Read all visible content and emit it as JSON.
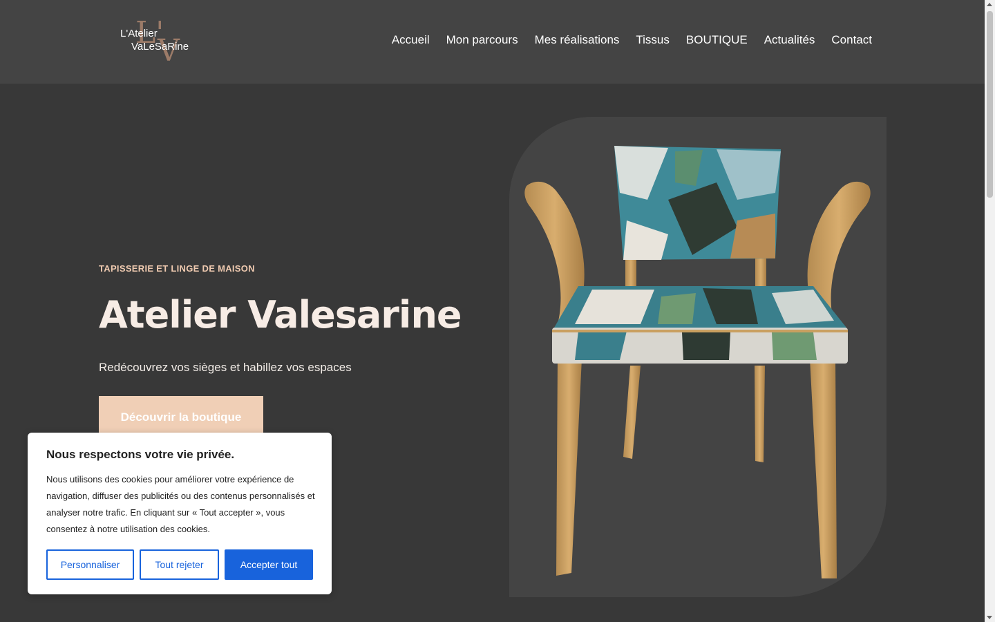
{
  "header": {
    "logo": {
      "line1": "L'Atelier",
      "line2": "VaLeSaRine",
      "mark1": "L'",
      "mark2": "V"
    },
    "nav": [
      "Accueil",
      "Mon parcours",
      "Mes réalisations",
      "Tissus",
      "BOUTIQUE",
      "Actualités",
      "Contact"
    ]
  },
  "hero": {
    "eyebrow": "TAPISSERIE ET LINGE DE MAISON",
    "title": "Atelier Valesarine",
    "subtitle": "Redécouvrez vos sièges et habillez vos espaces",
    "cta": "Découvrir la boutique",
    "image_icon": "armchair-photo"
  },
  "cookie": {
    "title": "Nous respectons votre vie privée.",
    "text": "Nous utilisons des cookies pour améliorer votre expérience de navigation, diffuser des publicités ou des contenus personnalisés et analyser notre trafic. En cliquant sur « Tout accepter », vous consentez à notre utilisation des cookies.",
    "customize": "Personnaliser",
    "reject": "Tout rejeter",
    "accept": "Accepter tout"
  },
  "colors": {
    "background": "#383838",
    "header": "#444444",
    "accent": "#efcab0",
    "cookie_blue": "#1863dc"
  }
}
